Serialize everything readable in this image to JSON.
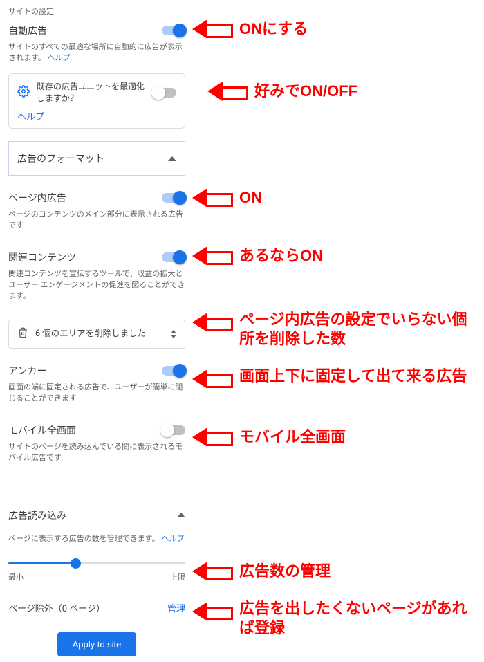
{
  "site_settings": "サイトの設定",
  "auto_ads": {
    "label": "自動広告",
    "desc_prefix": "サイトのすべての最適な場所に自動的に広告が表示されます。",
    "help": "ヘルプ"
  },
  "optimize_card": {
    "text": "既存の広告ユニットを最適化しますか？",
    "help": "ヘルプ"
  },
  "formats_header": "広告のフォーマット",
  "inpage": {
    "label": "ページ内広告",
    "desc": "ページのコンテンツのメイン部分に表示される広告です"
  },
  "matched": {
    "label": "関連コンテンツ",
    "desc": "関連コンテンツを宣伝するツールで、収益の拡大とユーザー エンゲージメントの促進を図ることができます。"
  },
  "deleted": {
    "count_text": "6 個のエリアを削除しました"
  },
  "anchor": {
    "label": "アンカー",
    "desc": "画面の端に固定される広告で、ユーザーが簡単に閉じることができます"
  },
  "vignette": {
    "label": "モバイル全画面",
    "desc": "サイトのページを読み込んでいる間に表示されるモバイル広告です"
  },
  "load_header": "広告読み込み",
  "load_desc_prefix": "ページに表示する広告の数を管理できます。",
  "load_help": "ヘルプ",
  "slider": {
    "min": "最小",
    "max": "上限",
    "value_pct": 38
  },
  "exclusions": {
    "label_prefix": "ページ除外",
    "count_text": "（0 ページ）",
    "manage": "管理"
  },
  "apply": "Apply to site",
  "annotations": {
    "a1": "ONにする",
    "a2": "好みでON/OFF",
    "a3": "ON",
    "a4": "あるならON",
    "a5": "ページ内広告の設定でいらない個所を削除した数",
    "a6": "画面上下に固定して出て来る広告",
    "a7": "モバイル全画面",
    "a8": "広告数の管理",
    "a9": "広告を出したくないページがあれば登録"
  }
}
